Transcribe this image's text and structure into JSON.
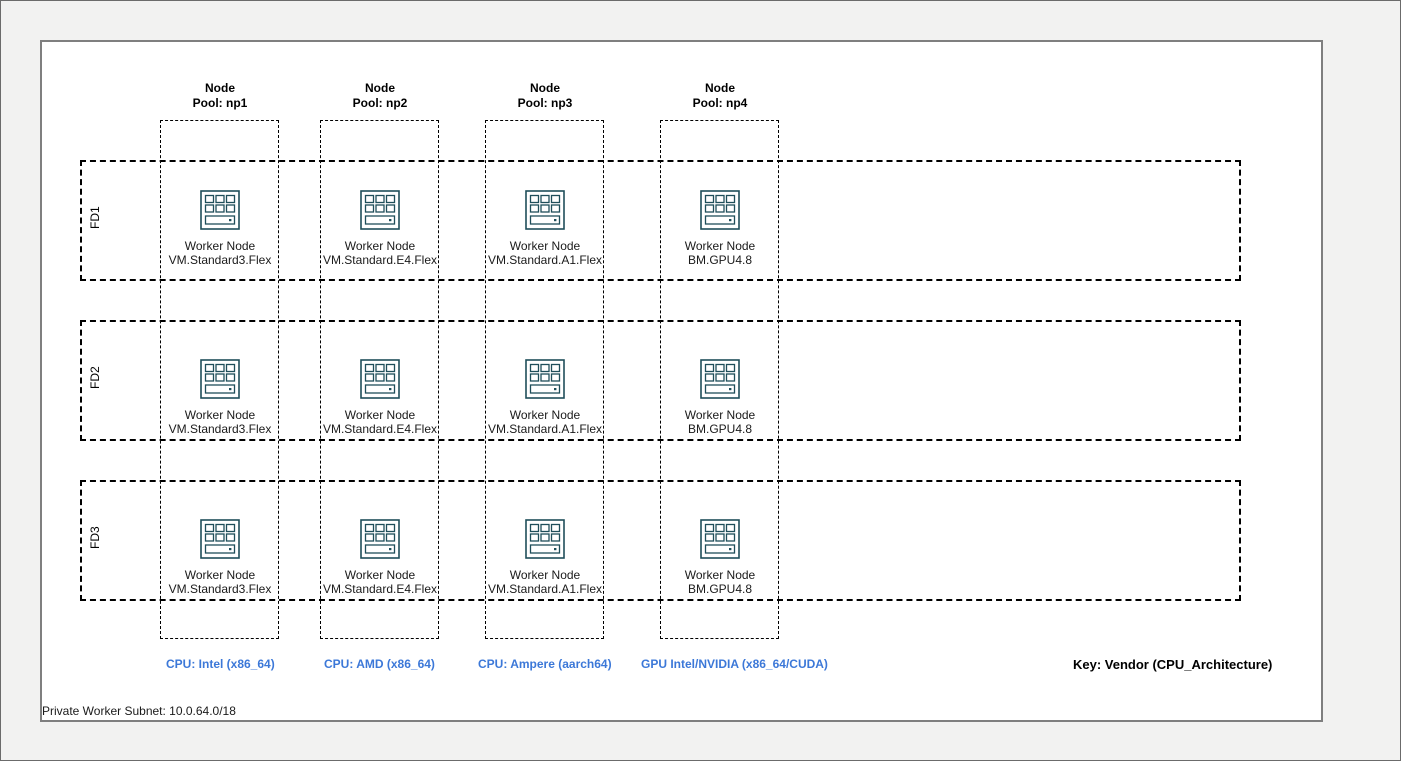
{
  "subnet": {
    "label": "Private Worker Subnet: 10.0.64.0/18"
  },
  "key": {
    "label": "Key: Vendor (CPU_Architecture)"
  },
  "node_pools": [
    {
      "header_line1": "Node",
      "header_line2": "Pool: np1",
      "cpu_label": "CPU: Intel (x86_64)",
      "shape": "VM.Standard3.Flex"
    },
    {
      "header_line1": "Node",
      "header_line2": "Pool: np2",
      "cpu_label": "CPU: AMD (x86_64)",
      "shape": "VM.Standard.E4.Flex"
    },
    {
      "header_line1": "Node",
      "header_line2": "Pool: np3",
      "cpu_label": "CPU: Ampere (aarch64)",
      "shape": "VM.Standard.A1.Flex"
    },
    {
      "header_line1": "Node",
      "header_line2": "Pool: np4",
      "cpu_label": "GPU Intel/NVIDIA (x86_64/CUDA)",
      "shape": "BM.GPU4.8"
    }
  ],
  "fault_domains": [
    {
      "label": "FD1"
    },
    {
      "label": "FD2"
    },
    {
      "label": "FD3"
    }
  ],
  "worker_node_label": "Worker Node",
  "colors": {
    "cpu_label": "#3c78d8",
    "icon_stroke": "#1f4e5a",
    "frame_background": "#f2f2f1"
  },
  "icons": {
    "worker_node": "server-rack-icon"
  }
}
